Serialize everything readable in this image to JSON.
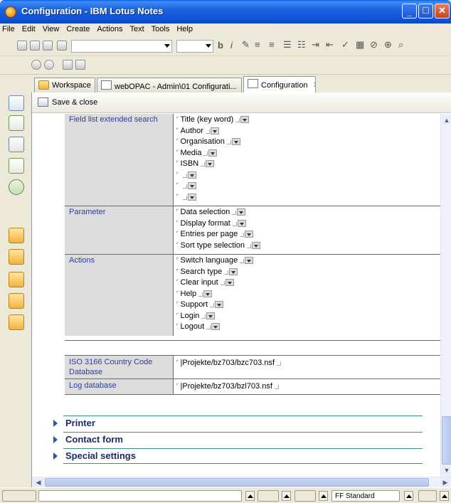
{
  "window": {
    "title": "Configuration - IBM Lotus Notes"
  },
  "menu": [
    "File",
    "Edit",
    "View",
    "Create",
    "Actions",
    "Text",
    "Tools",
    "Help"
  ],
  "tabs": [
    {
      "label": "Workspace",
      "icon": "folder-icon"
    },
    {
      "label": "webOPAC - Admin\\01 Configurati...",
      "icon": "database-icon"
    },
    {
      "label": "Configuration",
      "icon": "document-icon"
    }
  ],
  "action_bar": {
    "save_close": "Save & close"
  },
  "form": {
    "rows": [
      {
        "label": "Field list extended search",
        "values": [
          "Title (key word)",
          "Author",
          "Organisation",
          "Media",
          "ISBN",
          "",
          "",
          ""
        ]
      },
      {
        "label": "Parameter",
        "values": [
          "Data selection",
          "Display format",
          "Entries per page",
          "Sort type selection"
        ]
      },
      {
        "label": "Actions",
        "values": [
          "Switch language",
          "Search type",
          "Clear input",
          "Help",
          "Support",
          "Login",
          "Logout"
        ]
      }
    ],
    "db_rows": [
      {
        "label": "ISO 3166 Country Code Database",
        "value": "|Projekte/bz703/bzc703.nsf"
      },
      {
        "label": "Log database",
        "value": "|Projekte/bz703/bzl703.nsf"
      }
    ]
  },
  "sections": [
    "Printer",
    "Contact form",
    "Special settings"
  ],
  "status": {
    "font_style": "FF Standard"
  },
  "colors": {
    "title_bar": "#0d51d6",
    "label_bg": "#dcdcdc",
    "label_text": "#2d3f9e",
    "section_text": "#1b2a6f",
    "section_rule": "#3f8f8f"
  }
}
